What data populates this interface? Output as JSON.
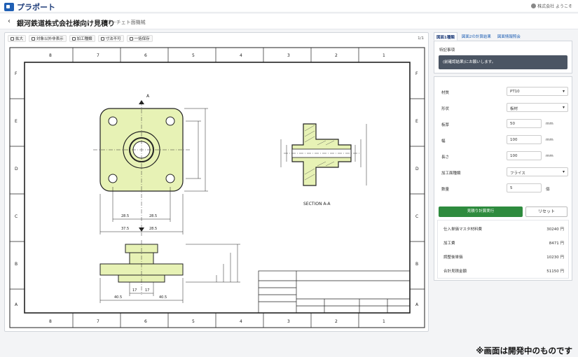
{
  "app": {
    "brand": "プラポート",
    "welcome": "株式会社 ようこそ"
  },
  "header": {
    "back_label": "‹",
    "title": "銀河鉄道株式会社様向け見積り",
    "subtitle": "アーチェト面機械"
  },
  "toolbar": {
    "buttons": [
      {
        "label": "拡大",
        "icon": "zoom-icon"
      },
      {
        "label": "対象以外非表示",
        "icon": "hide-icon"
      },
      {
        "label": "加工種類",
        "icon": "process-icon"
      },
      {
        "label": "寸法不可",
        "icon": "dimension-icon"
      },
      {
        "label": "一括保存",
        "icon": "save-icon"
      }
    ],
    "page_indicator": "1/1"
  },
  "drawing": {
    "section_label": "SECTION A-A",
    "view_marker": "A",
    "columns": [
      "8",
      "7",
      "6",
      "5",
      "4",
      "3",
      "2",
      "1"
    ],
    "rows": [
      "F",
      "E",
      "D",
      "C",
      "B",
      "A"
    ],
    "dims": {
      "d1": "28.5",
      "d2": "28.5",
      "d3": "37.5",
      "d4": "28.5",
      "d5": "17",
      "d6": "17",
      "d7": "40.5",
      "d8": "40.5"
    }
  },
  "side": {
    "tabs": [
      "図面1種類",
      "図面2の計算結果",
      "図面情報照会"
    ],
    "notice_label": "特記事項",
    "notice_text": "(前確認結果)にお願いします。",
    "fields": [
      {
        "label": "材質",
        "type": "select",
        "value": "PT10"
      },
      {
        "label": "形状",
        "type": "select",
        "value": "板材"
      },
      {
        "label": "板厚",
        "type": "input",
        "value": "50",
        "unit": "mm"
      },
      {
        "label": "幅",
        "type": "input",
        "value": "100",
        "unit": "mm"
      },
      {
        "label": "長さ",
        "type": "input",
        "value": "100",
        "unit": "mm"
      },
      {
        "label": "加工面種類",
        "type": "select",
        "value": "フライス"
      },
      {
        "label": "数量",
        "type": "input",
        "value": "5",
        "unit": "個"
      }
    ],
    "calc_button": "見積り計算実行",
    "reset_button": "リセット",
    "results": [
      {
        "label": "仕入単価マスタ材料費",
        "value": "30240",
        "unit": "円"
      },
      {
        "label": "加工費",
        "value": "8471",
        "unit": "円"
      },
      {
        "label": "調整後単価",
        "value": "10230",
        "unit": "円"
      },
      {
        "label": "合計見積金額",
        "value": "51150",
        "unit": "円"
      }
    ]
  },
  "footer": {
    "disclaimer": "※画面は開発中のものです"
  },
  "colors": {
    "brand": "#1f3d7a",
    "part_fill": "#e7f2b5",
    "calc_button": "#2e8b3e",
    "notice_box": "#4b5563"
  }
}
